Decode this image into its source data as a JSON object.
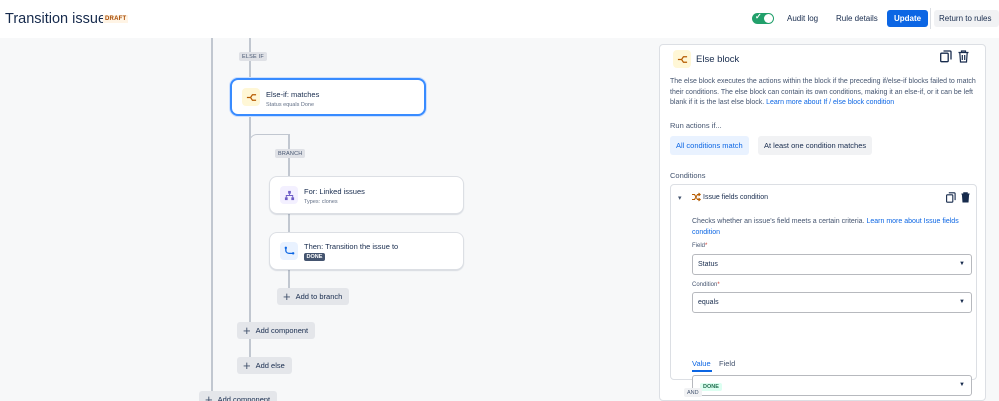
{
  "header": {
    "title": "Transition issue",
    "status_badge": "DRAFT",
    "audit_log": "Audit log",
    "rule_details": "Rule details",
    "update": "Update",
    "return_to_rules": "Return to rules",
    "rule_enabled": true
  },
  "canvas": {
    "else_if_tag": "ELSE IF",
    "else_if_node": {
      "title": "Else-if: matches",
      "subtitle": "Status equals Done"
    },
    "branch_tag": "BRANCH",
    "for_node": {
      "title": "For: Linked issues",
      "subtitle": "Types: clones"
    },
    "then_node": {
      "title": "Then: Transition the issue to",
      "status": "DONE"
    },
    "add_to_branch": "Add to branch",
    "add_component": "Add component",
    "add_else": "Add else",
    "add_component_outer": "Add component"
  },
  "panel": {
    "title": "Else block",
    "description": "The else block executes the actions within the block if the preceding if/else-if blocks failed to match their conditions. The else block can contain its own conditions, making it an else-if, or it can be left blank if it is the last else block. ",
    "description_link": "Learn more about If / else block condition",
    "run_actions_label": "Run actions if...",
    "option_all": "All conditions match",
    "option_any": "At least one condition matches",
    "conditions_label": "Conditions",
    "condition": {
      "title": "Issue fields condition",
      "description": "Checks whether an issue's field meets a certain criteria. ",
      "description_link": "Learn more about Issue fields condition",
      "field_label": "Field",
      "field_value": "Status",
      "condition_label": "Condition",
      "condition_value": "equals",
      "tab_value": "Value",
      "tab_field": "Field",
      "value": "DONE"
    },
    "and_tag": "AND"
  },
  "colors": {
    "primary": "#0c66e4",
    "toggle_on": "#22a06b",
    "selected_border": "#388bff",
    "done_green": "#216e4e"
  }
}
